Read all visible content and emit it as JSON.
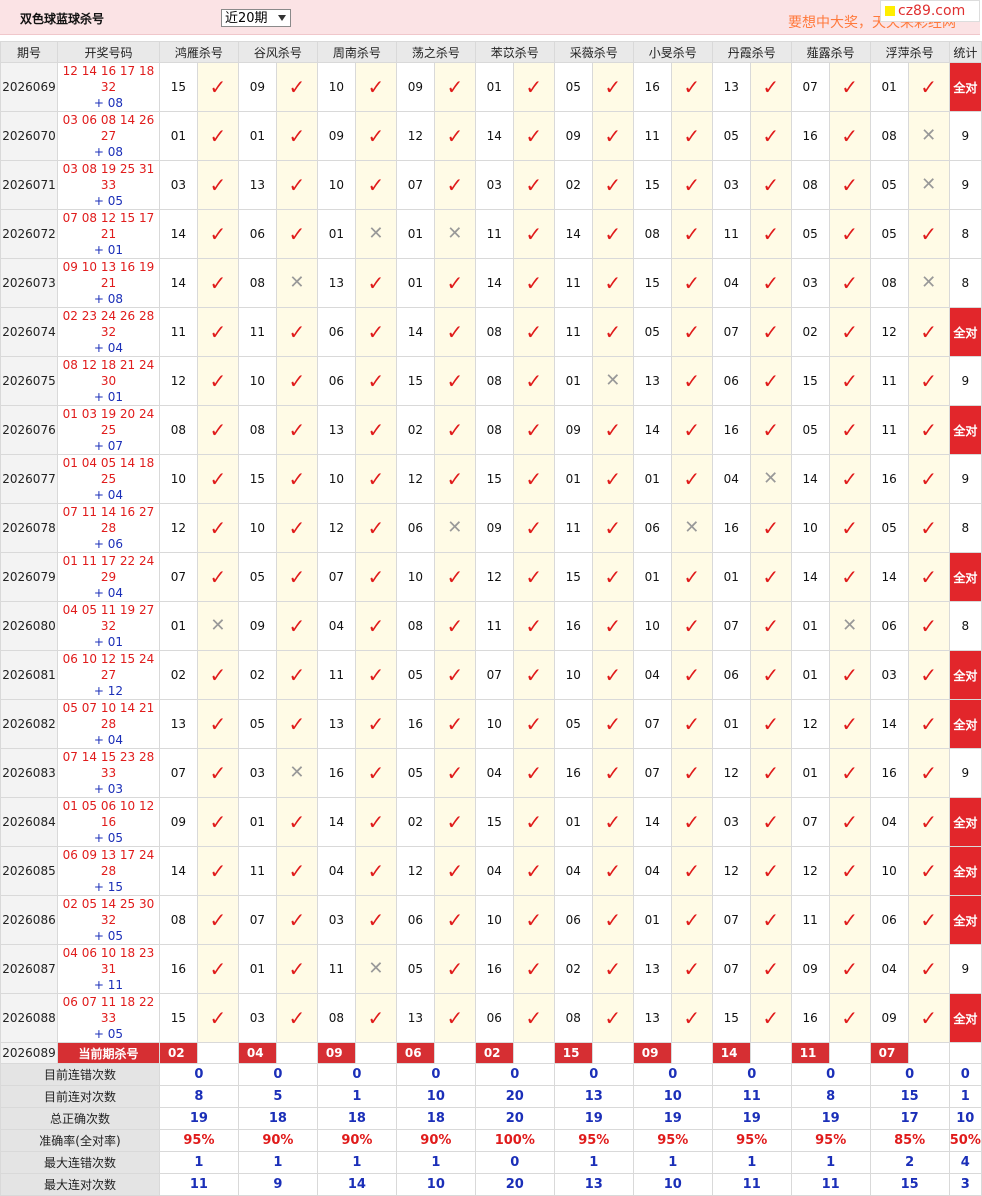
{
  "header": {
    "title": "双色球蓝球杀号",
    "period_select": "近20期",
    "slogan": "要想中大奖，天天来彩经网",
    "logo": "cz89.com"
  },
  "columns": [
    "期号",
    "开奖号码",
    "鸿雁杀号",
    "谷风杀号",
    "周南杀号",
    "荡之杀号",
    "苯苡杀号",
    "采薇杀号",
    "小旻杀号",
    "丹霞杀号",
    "薤露杀号",
    "浮萍杀号",
    "统计"
  ],
  "rows": [
    {
      "issue": "2026069",
      "reds": "12 14 16 17 18 32",
      "blue": "+ 08",
      "kills": [
        "15",
        "09",
        "10",
        "09",
        "01",
        "05",
        "16",
        "13",
        "07",
        "01"
      ],
      "ok": [
        1,
        1,
        1,
        1,
        1,
        1,
        1,
        1,
        1,
        1
      ],
      "stat": "全对"
    },
    {
      "issue": "2026070",
      "reds": "03 06 08 14 26 27",
      "blue": "+ 08",
      "kills": [
        "01",
        "01",
        "09",
        "12",
        "14",
        "09",
        "11",
        "05",
        "16",
        "08"
      ],
      "ok": [
        1,
        1,
        1,
        1,
        1,
        1,
        1,
        1,
        1,
        0
      ],
      "stat": "9"
    },
    {
      "issue": "2026071",
      "reds": "03 08 19 25 31 33",
      "blue": "+ 05",
      "kills": [
        "03",
        "13",
        "10",
        "07",
        "03",
        "02",
        "15",
        "03",
        "08",
        "05"
      ],
      "ok": [
        1,
        1,
        1,
        1,
        1,
        1,
        1,
        1,
        1,
        0
      ],
      "stat": "9"
    },
    {
      "issue": "2026072",
      "reds": "07 08 12 15 17 21",
      "blue": "+ 01",
      "kills": [
        "14",
        "06",
        "01",
        "01",
        "11",
        "14",
        "08",
        "11",
        "05",
        "05"
      ],
      "ok": [
        1,
        1,
        0,
        0,
        1,
        1,
        1,
        1,
        1,
        1
      ],
      "stat": "8"
    },
    {
      "issue": "2026073",
      "reds": "09 10 13 16 19 21",
      "blue": "+ 08",
      "kills": [
        "14",
        "08",
        "13",
        "01",
        "14",
        "11",
        "15",
        "04",
        "03",
        "08"
      ],
      "ok": [
        1,
        0,
        1,
        1,
        1,
        1,
        1,
        1,
        1,
        0
      ],
      "stat": "8"
    },
    {
      "issue": "2026074",
      "reds": "02 23 24 26 28 32",
      "blue": "+ 04",
      "kills": [
        "11",
        "11",
        "06",
        "14",
        "08",
        "11",
        "05",
        "07",
        "02",
        "12"
      ],
      "ok": [
        1,
        1,
        1,
        1,
        1,
        1,
        1,
        1,
        1,
        1
      ],
      "stat": "全对"
    },
    {
      "issue": "2026075",
      "reds": "08 12 18 21 24 30",
      "blue": "+ 01",
      "kills": [
        "12",
        "10",
        "06",
        "15",
        "08",
        "01",
        "13",
        "06",
        "15",
        "11"
      ],
      "ok": [
        1,
        1,
        1,
        1,
        1,
        0,
        1,
        1,
        1,
        1
      ],
      "stat": "9"
    },
    {
      "issue": "2026076",
      "reds": "01 03 19 20 24 25",
      "blue": "+ 07",
      "kills": [
        "08",
        "08",
        "13",
        "02",
        "08",
        "09",
        "14",
        "16",
        "05",
        "11"
      ],
      "ok": [
        1,
        1,
        1,
        1,
        1,
        1,
        1,
        1,
        1,
        1
      ],
      "stat": "全对"
    },
    {
      "issue": "2026077",
      "reds": "01 04 05 14 18 25",
      "blue": "+ 04",
      "kills": [
        "10",
        "15",
        "10",
        "12",
        "15",
        "01",
        "01",
        "04",
        "14",
        "16"
      ],
      "ok": [
        1,
        1,
        1,
        1,
        1,
        1,
        1,
        0,
        1,
        1
      ],
      "stat": "9"
    },
    {
      "issue": "2026078",
      "reds": "07 11 14 16 27 28",
      "blue": "+ 06",
      "kills": [
        "12",
        "10",
        "12",
        "06",
        "09",
        "11",
        "06",
        "16",
        "10",
        "05"
      ],
      "ok": [
        1,
        1,
        1,
        0,
        1,
        1,
        0,
        1,
        1,
        1
      ],
      "stat": "8"
    },
    {
      "issue": "2026079",
      "reds": "01 11 17 22 24 29",
      "blue": "+ 04",
      "kills": [
        "07",
        "05",
        "07",
        "10",
        "12",
        "15",
        "01",
        "01",
        "14",
        "14"
      ],
      "ok": [
        1,
        1,
        1,
        1,
        1,
        1,
        1,
        1,
        1,
        1
      ],
      "stat": "全对"
    },
    {
      "issue": "2026080",
      "reds": "04 05 11 19 27 32",
      "blue": "+ 01",
      "kills": [
        "01",
        "09",
        "04",
        "08",
        "11",
        "16",
        "10",
        "07",
        "01",
        "06"
      ],
      "ok": [
        0,
        1,
        1,
        1,
        1,
        1,
        1,
        1,
        0,
        1
      ],
      "stat": "8"
    },
    {
      "issue": "2026081",
      "reds": "06 10 12 15 24 27",
      "blue": "+ 12",
      "kills": [
        "02",
        "02",
        "11",
        "05",
        "07",
        "10",
        "04",
        "06",
        "01",
        "03"
      ],
      "ok": [
        1,
        1,
        1,
        1,
        1,
        1,
        1,
        1,
        1,
        1
      ],
      "stat": "全对"
    },
    {
      "issue": "2026082",
      "reds": "05 07 10 14 21 28",
      "blue": "+ 04",
      "kills": [
        "13",
        "05",
        "13",
        "16",
        "10",
        "05",
        "07",
        "01",
        "12",
        "14"
      ],
      "ok": [
        1,
        1,
        1,
        1,
        1,
        1,
        1,
        1,
        1,
        1
      ],
      "stat": "全对"
    },
    {
      "issue": "2026083",
      "reds": "07 14 15 23 28 33",
      "blue": "+ 03",
      "kills": [
        "07",
        "03",
        "16",
        "05",
        "04",
        "16",
        "07",
        "12",
        "01",
        "16"
      ],
      "ok": [
        1,
        0,
        1,
        1,
        1,
        1,
        1,
        1,
        1,
        1
      ],
      "stat": "9"
    },
    {
      "issue": "2026084",
      "reds": "01 05 06 10 12 16",
      "blue": "+ 05",
      "kills": [
        "09",
        "01",
        "14",
        "02",
        "15",
        "01",
        "14",
        "03",
        "07",
        "04"
      ],
      "ok": [
        1,
        1,
        1,
        1,
        1,
        1,
        1,
        1,
        1,
        1
      ],
      "stat": "全对"
    },
    {
      "issue": "2026085",
      "reds": "06 09 13 17 24 28",
      "blue": "+ 15",
      "kills": [
        "14",
        "11",
        "04",
        "12",
        "04",
        "04",
        "04",
        "12",
        "12",
        "10"
      ],
      "ok": [
        1,
        1,
        1,
        1,
        1,
        1,
        1,
        1,
        1,
        1
      ],
      "stat": "全对"
    },
    {
      "issue": "2026086",
      "reds": "02 05 14 25 30 32",
      "blue": "+ 05",
      "kills": [
        "08",
        "07",
        "03",
        "06",
        "10",
        "06",
        "01",
        "07",
        "11",
        "06"
      ],
      "ok": [
        1,
        1,
        1,
        1,
        1,
        1,
        1,
        1,
        1,
        1
      ],
      "stat": "全对"
    },
    {
      "issue": "2026087",
      "reds": "04 06 10 18 23 31",
      "blue": "+ 11",
      "kills": [
        "16",
        "01",
        "11",
        "05",
        "16",
        "02",
        "13",
        "07",
        "09",
        "04"
      ],
      "ok": [
        1,
        1,
        0,
        1,
        1,
        1,
        1,
        1,
        1,
        1
      ],
      "stat": "9"
    },
    {
      "issue": "2026088",
      "reds": "06 07 11 18 22 33",
      "blue": "+ 05",
      "kills": [
        "15",
        "03",
        "08",
        "13",
        "06",
        "08",
        "13",
        "15",
        "16",
        "09"
      ],
      "ok": [
        1,
        1,
        1,
        1,
        1,
        1,
        1,
        1,
        1,
        1
      ],
      "stat": "全对"
    }
  ],
  "current": {
    "issue": "2026089",
    "label": "当前期杀号",
    "kills": [
      "02",
      "04",
      "09",
      "06",
      "02",
      "15",
      "09",
      "14",
      "11",
      "07"
    ]
  },
  "stats": [
    {
      "label": "目前连错次数",
      "values": [
        "0",
        "0",
        "0",
        "0",
        "0",
        "0",
        "0",
        "0",
        "0",
        "0",
        "0"
      ],
      "color": "#1b2fb8"
    },
    {
      "label": "目前连对次数",
      "values": [
        "8",
        "5",
        "1",
        "10",
        "20",
        "13",
        "10",
        "11",
        "8",
        "15",
        "1"
      ],
      "color": "#1b2fb8"
    },
    {
      "label": "总正确次数",
      "values": [
        "19",
        "18",
        "18",
        "18",
        "20",
        "19",
        "19",
        "19",
        "19",
        "17",
        "10"
      ],
      "color": "#1b2fb8"
    },
    {
      "label": "准确率(全对率)",
      "values": [
        "95%",
        "90%",
        "90%",
        "90%",
        "100%",
        "95%",
        "95%",
        "95%",
        "95%",
        "85%",
        "50%"
      ],
      "color": "#e01b1b"
    },
    {
      "label": "最大连错次数",
      "values": [
        "1",
        "1",
        "1",
        "1",
        "0",
        "1",
        "1",
        "1",
        "1",
        "2",
        "4"
      ],
      "color": "#1b2fb8"
    },
    {
      "label": "最大连对次数",
      "values": [
        "11",
        "9",
        "14",
        "10",
        "20",
        "13",
        "10",
        "11",
        "11",
        "15",
        "3"
      ],
      "color": "#1b2fb8"
    }
  ],
  "marks": {
    "correct_icon": "check-icon",
    "wrong_icon": "cross-icon",
    "correct_color": "#e01b1b",
    "wrong_color": "#999999"
  }
}
